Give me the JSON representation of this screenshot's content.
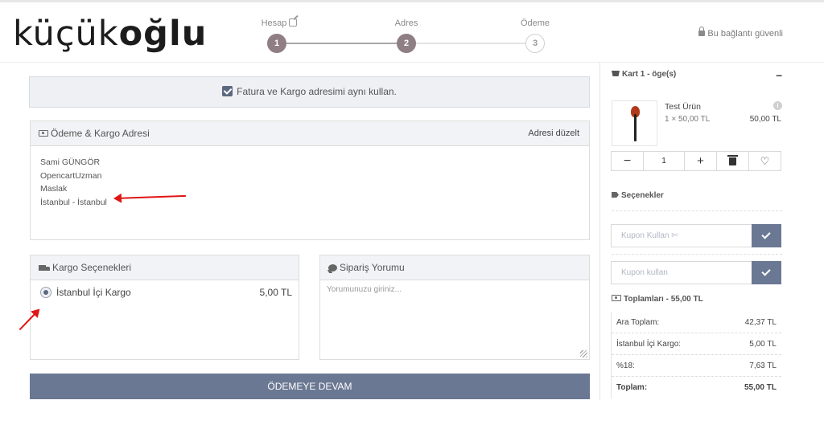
{
  "header": {
    "logo_light": "küçük",
    "logo_bold": "oğlu",
    "secure_text": "Bu bağlantı güvenli",
    "steps": [
      {
        "label": "Hesap",
        "number": "1",
        "state": "done"
      },
      {
        "label": "Adres",
        "number": "2",
        "state": "done"
      },
      {
        "label": "Ödeme",
        "number": "3",
        "state": "todo"
      }
    ]
  },
  "main": {
    "same_address_label": "Fatura ve Kargo adresimi aynı kullan.",
    "address_panel": {
      "title": "Ödeme & Kargo Adresi",
      "edit_link": "Adresi düzelt",
      "lines": [
        "Sami GÜNGÖR",
        "OpencartUzman",
        "Maslak",
        "İstanbul - İstanbul"
      ]
    },
    "shipping_panel": {
      "title": "Kargo Seçenekleri",
      "option_label": "İstanbul İçi Kargo",
      "option_price": "5,00 TL"
    },
    "comment_panel": {
      "title": "Sipariş Yorumu",
      "placeholder": "Yorumunuzu giriniz..."
    },
    "continue_button": "ÖDEMEYE DEVAM"
  },
  "sidebar": {
    "cart_title": "Kart 1 - öge(s)",
    "collapse_symbol": "–",
    "product": {
      "name": "Test Ürün",
      "qty_line": "1 × 50,00 TL",
      "price": "50,00 TL",
      "quantity": "1"
    },
    "options_title": "Seçenekler",
    "coupon_placeholder_1": "Kupon Kullan ✄",
    "coupon_placeholder_2": "Kupon kullan",
    "totals_title": "Toplamları - 55,00 TL",
    "totals": [
      {
        "label": "Ara Toplam:",
        "value": "42,37 TL"
      },
      {
        "label": "İstanbul İçi Kargo:",
        "value": "5,00 TL"
      },
      {
        "label": "%18:",
        "value": "7,63 TL"
      },
      {
        "label": "Toplam:",
        "value": "55,00 TL"
      }
    ]
  },
  "colors": {
    "accent": "#6b7893",
    "step_done": "#8f7e84",
    "annotation_arrow": "#e01515"
  }
}
